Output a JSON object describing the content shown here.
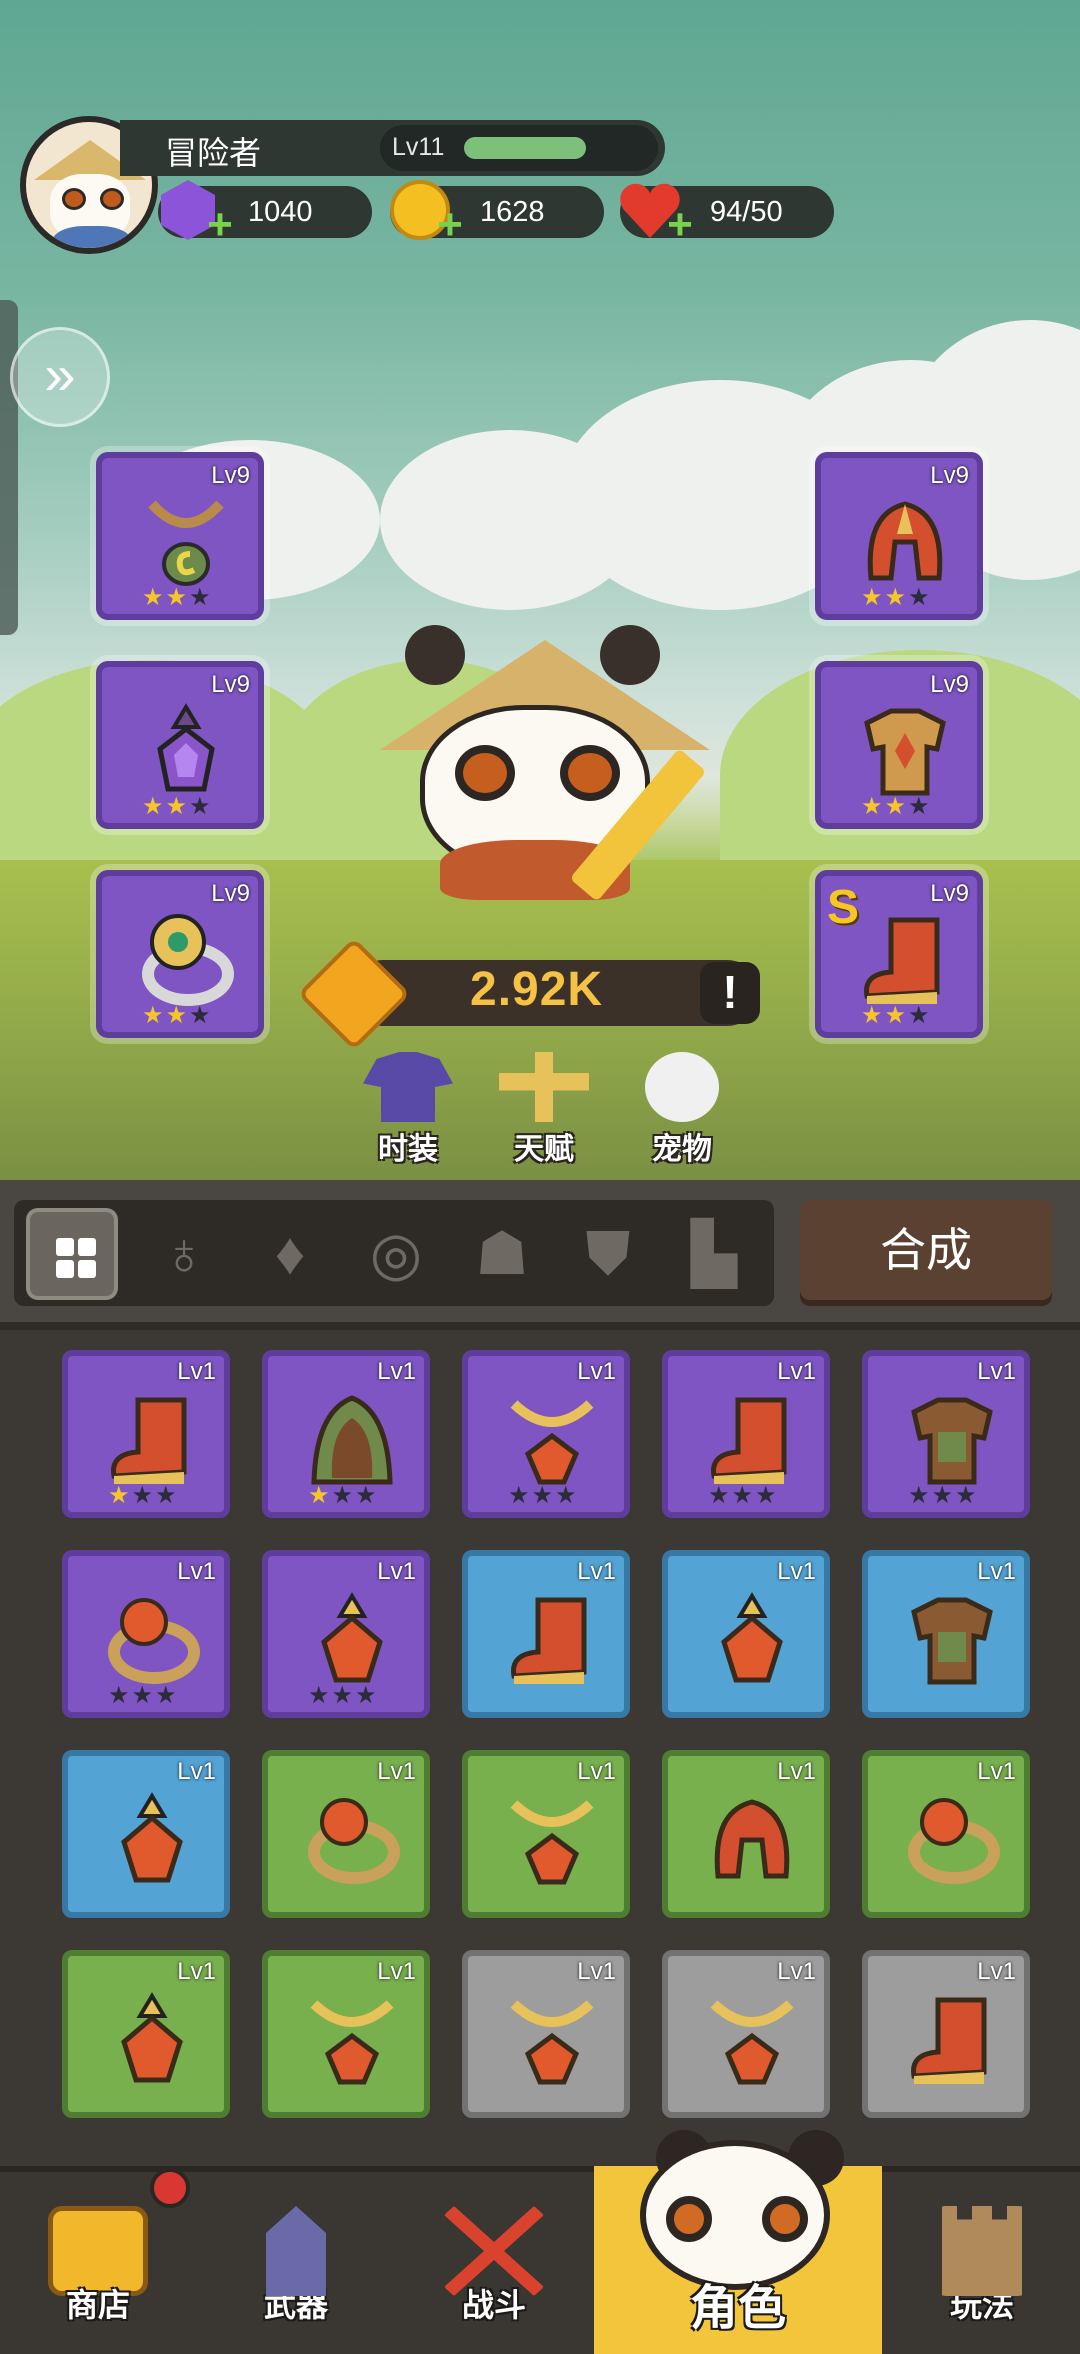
{
  "player": {
    "name": "冒险者",
    "level": "Lv11",
    "xp_fraction": 0.55
  },
  "resources": {
    "gems": "1040",
    "coins": "1628",
    "hearts": "94/50"
  },
  "equipped": {
    "left": [
      {
        "level": "Lv9",
        "stars": 2,
        "icon": "necklace-icon"
      },
      {
        "level": "Lv9",
        "stars": 2,
        "icon": "amulet-icon"
      },
      {
        "level": "Lv9",
        "stars": 2,
        "icon": "ring-icon"
      }
    ],
    "right": [
      {
        "level": "Lv9",
        "stars": 2,
        "icon": "helmet-icon"
      },
      {
        "level": "Lv9",
        "stars": 2,
        "icon": "armor-icon"
      },
      {
        "level": "Lv9",
        "stars": 2,
        "icon": "boots-icon",
        "badge": "S"
      }
    ]
  },
  "power": {
    "value": "2.92K"
  },
  "features": {
    "costume": "时装",
    "talent": "天赋",
    "pet": "宠物"
  },
  "filters": [
    "all",
    "necklace",
    "amulet",
    "ring",
    "helmet",
    "armor",
    "boots"
  ],
  "craft_label": "合成",
  "inventory": [
    {
      "level": "Lv1",
      "rarity": "purple",
      "stars": 1,
      "icon": "boots-icon"
    },
    {
      "level": "Lv1",
      "rarity": "purple",
      "stars": 1,
      "icon": "cloak-icon"
    },
    {
      "level": "Lv1",
      "rarity": "purple",
      "stars": 0,
      "icon": "necklace-icon"
    },
    {
      "level": "Lv1",
      "rarity": "purple",
      "stars": 0,
      "icon": "boots-icon"
    },
    {
      "level": "Lv1",
      "rarity": "purple",
      "stars": 0,
      "icon": "armor-icon"
    },
    {
      "level": "Lv1",
      "rarity": "purple",
      "stars": 0,
      "icon": "ring-icon"
    },
    {
      "level": "Lv1",
      "rarity": "purple",
      "stars": 0,
      "icon": "amulet-icon"
    },
    {
      "level": "Lv1",
      "rarity": "blue",
      "icon": "boots-icon"
    },
    {
      "level": "Lv1",
      "rarity": "blue",
      "icon": "amulet-icon"
    },
    {
      "level": "Lv1",
      "rarity": "blue",
      "icon": "armor-icon"
    },
    {
      "level": "Lv1",
      "rarity": "blue",
      "icon": "amulet-icon"
    },
    {
      "level": "Lv1",
      "rarity": "green",
      "icon": "ring-icon"
    },
    {
      "level": "Lv1",
      "rarity": "green",
      "icon": "necklace-icon"
    },
    {
      "level": "Lv1",
      "rarity": "green",
      "icon": "helmet-icon"
    },
    {
      "level": "Lv1",
      "rarity": "green",
      "icon": "ring-icon"
    },
    {
      "level": "Lv1",
      "rarity": "green",
      "icon": "amulet-icon"
    },
    {
      "level": "Lv1",
      "rarity": "green",
      "icon": "necklace-icon"
    },
    {
      "level": "Lv1",
      "rarity": "gray",
      "icon": "necklace-icon"
    },
    {
      "level": "Lv1",
      "rarity": "gray",
      "icon": "necklace-icon"
    },
    {
      "level": "Lv1",
      "rarity": "gray",
      "icon": "boots-icon"
    }
  ],
  "nav": [
    {
      "label": "商店",
      "icon": "chest-icon",
      "has_badge": true
    },
    {
      "label": "武器",
      "icon": "castle-icon"
    },
    {
      "label": "战斗",
      "icon": "crossed-swords-icon"
    },
    {
      "label": "角色",
      "icon": "panda-icon",
      "active": true
    },
    {
      "label": "玩法",
      "icon": "tower-icon"
    }
  ],
  "colors": {
    "purple": "#7e55c2",
    "blue": "#53a4d4",
    "green": "#78b04e",
    "gray": "#9d9d9d",
    "star_on": "#f5c627",
    "power": "#f5c245",
    "nav_active": "#f3c53b"
  }
}
